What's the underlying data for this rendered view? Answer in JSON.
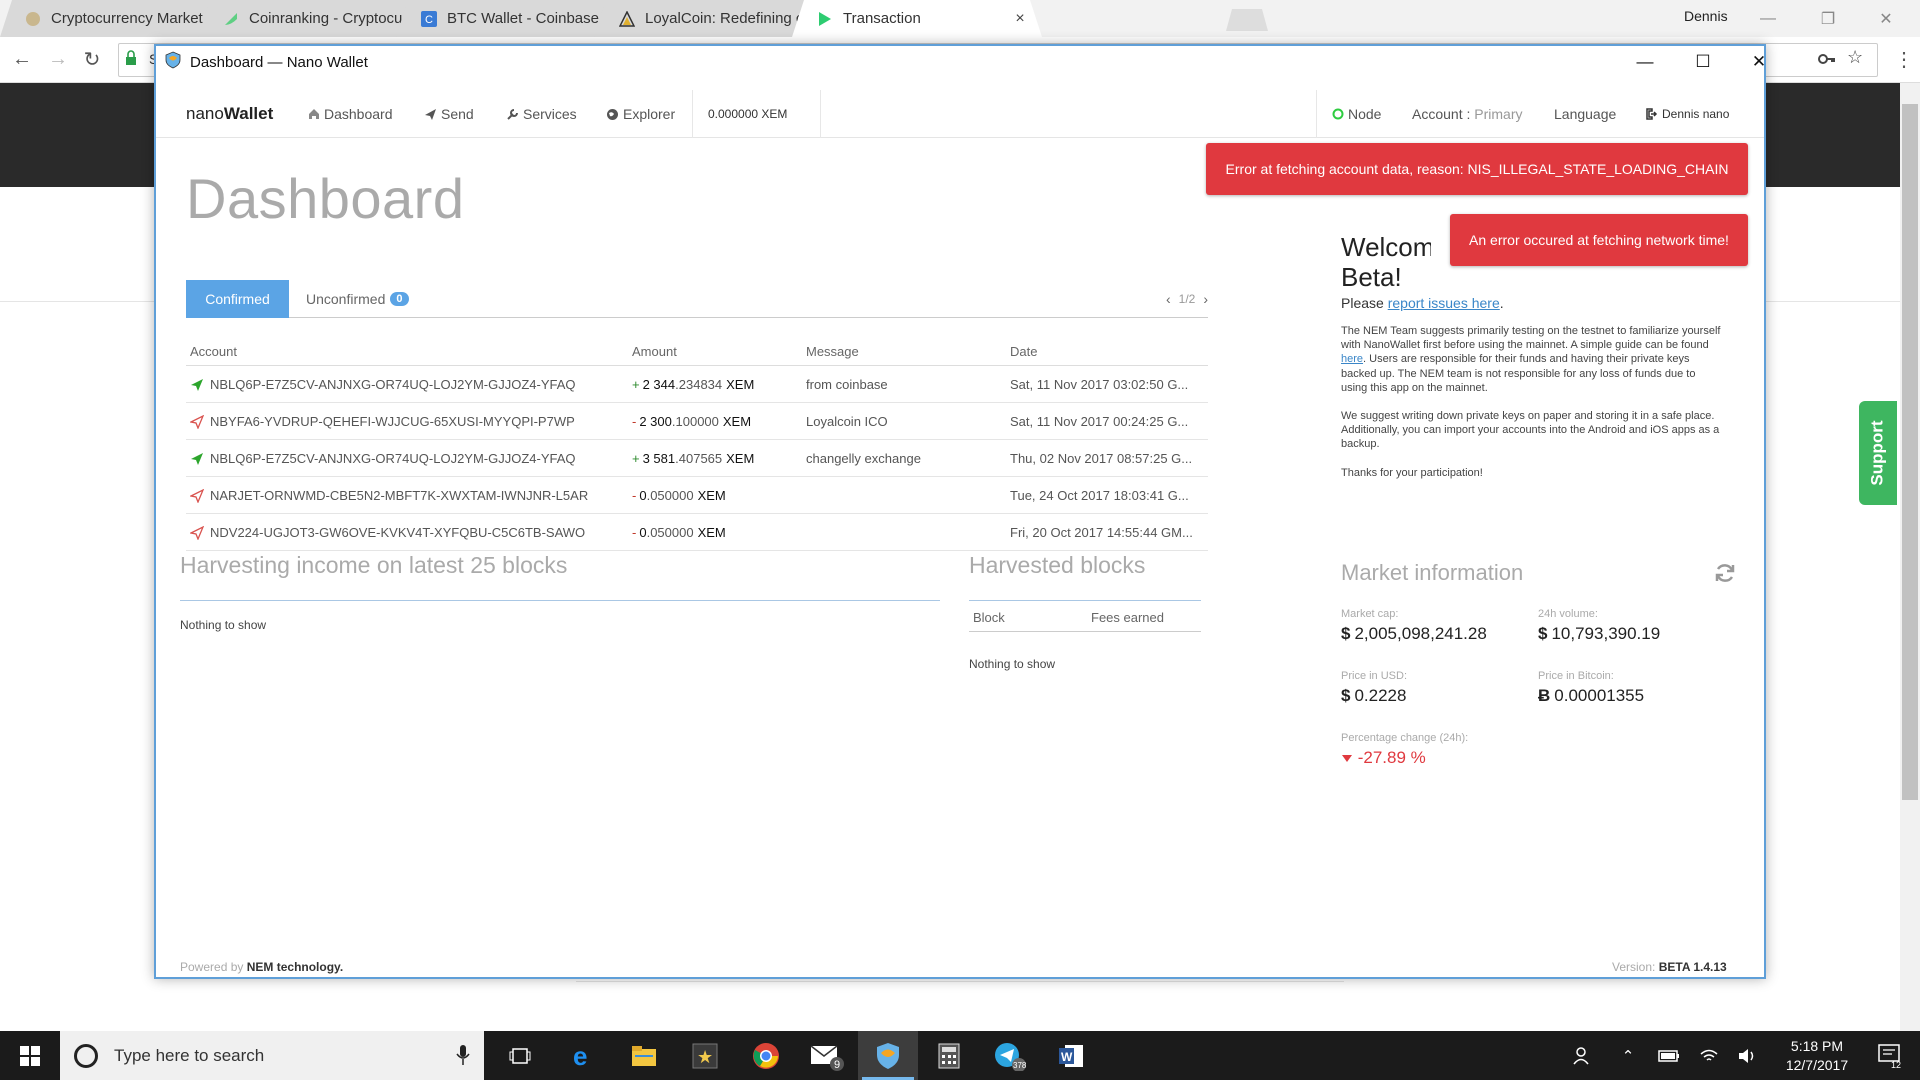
{
  "browser": {
    "tabs": [
      {
        "label": "Cryptocurrency Market C"
      },
      {
        "label": "Coinranking - Cryptocurr"
      },
      {
        "label": "BTC Wallet - Coinbase"
      },
      {
        "label": "LoyalCoin: Redefining cu"
      },
      {
        "label": "Transaction"
      }
    ],
    "profile": "Dennis",
    "address_fragment": "S"
  },
  "page": {
    "support_label": "Support"
  },
  "wallet_window": {
    "title": "Dashboard — Nano Wallet",
    "nav": {
      "brand_light": "nano",
      "brand_bold": "Wallet",
      "dashboard": "Dashboard",
      "send": "Send",
      "services": "Services",
      "explorer": "Explorer",
      "balance": "0.000000 XEM",
      "node": "Node",
      "account_label": "Account :",
      "account_value": "Primary",
      "language": "Language",
      "user": "Dennis nano"
    },
    "alerts": {
      "account_error": "Error at fetching account data, reason: NIS_ILLEGAL_STATE_LOADING_CHAIN",
      "network_error": "An error occured at fetching network time!"
    },
    "dashboard": {
      "title": "Dashboard",
      "tab_confirmed": "Confirmed",
      "tab_unconfirmed": "Unconfirmed",
      "unconfirmed_count": "0",
      "pagination": "1/2",
      "columns": {
        "account": "Account",
        "amount": "Amount",
        "message": "Message",
        "date": "Date"
      },
      "transactions": [
        {
          "direction": "incoming",
          "account": "NBLQ6P-E7Z5CV-ANJNXG-OR74UQ-LOJ2YM-GJJOZ4-YFAQ",
          "sign": "+",
          "amount_int": "2 344",
          "amount_dec": ".234834",
          "unit": "XEM",
          "message": "from coinbase",
          "date": "Sat, 11 Nov 2017 03:02:50 G..."
        },
        {
          "direction": "outgoing",
          "account": "NBYFA6-YVDRUP-QEHEFI-WJJCUG-65XUSI-MYYQPI-P7WP",
          "sign": "-",
          "amount_int": "2 300",
          "amount_dec": ".100000",
          "unit": "XEM",
          "message": "Loyalcoin ICO",
          "date": "Sat, 11 Nov 2017 00:24:25 G..."
        },
        {
          "direction": "incoming",
          "account": "NBLQ6P-E7Z5CV-ANJNXG-OR74UQ-LOJ2YM-GJJOZ4-YFAQ",
          "sign": "+",
          "amount_int": "3 581",
          "amount_dec": ".407565",
          "unit": "XEM",
          "message": "changelly exchange",
          "date": "Thu, 02 Nov 2017 08:57:25 G..."
        },
        {
          "direction": "outgoing",
          "account": "NARJET-ORNWMD-CBE5N2-MBFT7K-XWXTAM-IWNJNR-L5AR",
          "sign": "-",
          "amount_int": "0",
          "amount_dec": ".050000",
          "unit": "XEM",
          "message": "",
          "date": "Tue, 24 Oct 2017 18:03:41 G..."
        },
        {
          "direction": "outgoing",
          "account": "NDV224-UGJOT3-GW6OVE-KVKV4T-XYFQBU-C5C6TB-SAWO",
          "sign": "-",
          "amount_int": "0",
          "amount_dec": ".050000",
          "unit": "XEM",
          "message": "",
          "date": "Fri, 20 Oct 2017 14:55:44 GM..."
        }
      ],
      "harvesting_title": "Harvesting income on latest 25 blocks",
      "harvesting_empty": "Nothing to show",
      "harvested_title": "Harvested blocks",
      "harvested_col_block": "Block",
      "harvested_col_fees": "Fees earned",
      "harvested_empty": "Nothing to show"
    },
    "welcome": {
      "heading_line1": "Welcome",
      "heading_line2": "Beta!",
      "please": "Please",
      "report_link": "report issues here",
      "period": ".",
      "para1_a": "The NEM Team suggests primarily testing on the testnet to familiarize yourself with NanoWallet first before using the mainnet. A simple guide can be found",
      "para1_link": "here",
      "para1_b": ". Users are responsible for their funds and having their private keys backed up. The NEM team is not responsible for any loss of funds due to using this app on the mainnet.",
      "para2": "We suggest writing down private keys on paper and storing it in a safe place. Additionally, you can import your accounts into the Android and iOS apps as a backup.",
      "para3": "Thanks for your participation!"
    },
    "market": {
      "title": "Market information",
      "market_cap_label": "Market cap:",
      "market_cap_value": "2,005,098,241.28",
      "volume_label": "24h volume:",
      "volume_value": "10,793,390.19",
      "usd_label": "Price in USD:",
      "usd_value": "0.2228",
      "btc_label": "Price in Bitcoin:",
      "btc_value": "0.00001355",
      "change_label": "Percentage change (24h):",
      "change_value": "-27.89 %",
      "usd_symbol": "$",
      "btc_symbol": "Ƀ"
    },
    "footer": {
      "powered_prefix": "Powered by",
      "powered_bold": "NEM technology.",
      "version_prefix": "Version:",
      "version_bold": "BETA 1.4.13"
    }
  },
  "taskbar": {
    "search_placeholder": "Type here to search",
    "mail_badge": "9",
    "telegram_badge": "378",
    "time": "5:18 PM",
    "date": "12/7/2017",
    "notification_count": "12"
  },
  "colors": {
    "accent_blue": "#5ba4e5",
    "error_red": "#e0393f",
    "positive_green": "#2d8a2d",
    "window_border": "#5f9fd8"
  }
}
